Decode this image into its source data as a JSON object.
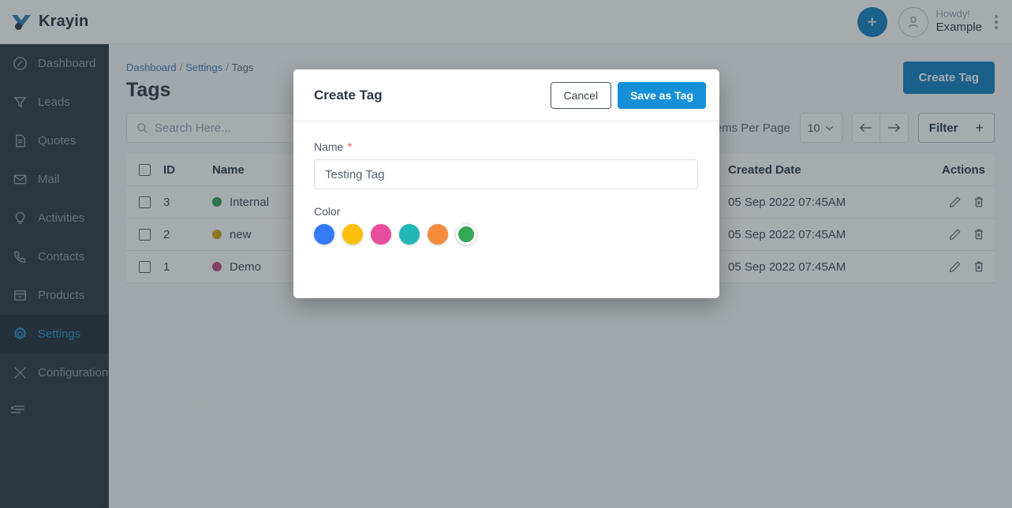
{
  "app": {
    "brand": "Krayin",
    "brand_color": "#2b7fb0"
  },
  "topbar": {
    "add_label": "+",
    "greeting_line1": "Howdy!",
    "greeting_line2": "Example"
  },
  "sidebar": {
    "items": [
      {
        "label": "Dashboard",
        "icon": "dashboard-icon",
        "active": false
      },
      {
        "label": "Leads",
        "icon": "funnel-icon",
        "active": false
      },
      {
        "label": "Quotes",
        "icon": "document-icon",
        "active": false
      },
      {
        "label": "Mail",
        "icon": "envelope-icon",
        "active": false
      },
      {
        "label": "Activities",
        "icon": "bulb-icon",
        "active": false
      },
      {
        "label": "Contacts",
        "icon": "phone-icon",
        "active": false
      },
      {
        "label": "Products",
        "icon": "box-icon",
        "active": false
      },
      {
        "label": "Settings",
        "icon": "gear-icon",
        "active": true
      },
      {
        "label": "Configuration",
        "icon": "tools-icon",
        "active": false
      }
    ],
    "collapse_icon": "collapse-menu-icon"
  },
  "page": {
    "breadcrumb": [
      {
        "label": "Dashboard",
        "link": true
      },
      {
        "label": "Settings",
        "link": true
      },
      {
        "label": "Tags",
        "link": false
      }
    ],
    "breadcrumb_sep": "/",
    "title": "Tags",
    "create_button": "Create Tag"
  },
  "toolbar": {
    "search_placeholder": "Search Here...",
    "items_per_page_label": "Items Per Page",
    "items_per_page_value": "10",
    "prev_icon": "arrow-left-icon",
    "next_icon": "arrow-right-icon",
    "filter_label": "Filter",
    "filter_plus": "+"
  },
  "table": {
    "columns": [
      "ID",
      "Name",
      "Created Date",
      "Actions"
    ],
    "rows": [
      {
        "id": "3",
        "name": "Internal",
        "color": "#2e9e53",
        "created": "05 Sep 2022 07:45AM"
      },
      {
        "id": "2",
        "name": "new",
        "color": "#cfa81b",
        "created": "05 Sep 2022 07:45AM"
      },
      {
        "id": "1",
        "name": "Demo",
        "color": "#bf4a81",
        "created": "05 Sep 2022 07:45AM"
      }
    ],
    "edit_icon": "pencil-icon",
    "delete_icon": "trash-icon"
  },
  "modal": {
    "title": "Create Tag",
    "cancel_label": "Cancel",
    "save_label": "Save as Tag",
    "name_label": "Name",
    "required_mark": "*",
    "name_value": "Testing Tag",
    "color_label": "Color",
    "colors": [
      {
        "hex": "#3479f6",
        "selected": false
      },
      {
        "hex": "#fcc00a",
        "selected": false
      },
      {
        "hex": "#e84d9e",
        "selected": false
      },
      {
        "hex": "#22b5b6",
        "selected": false
      },
      {
        "hex": "#f68b3c",
        "selected": false
      },
      {
        "hex": "#34a853",
        "selected": true
      }
    ]
  }
}
